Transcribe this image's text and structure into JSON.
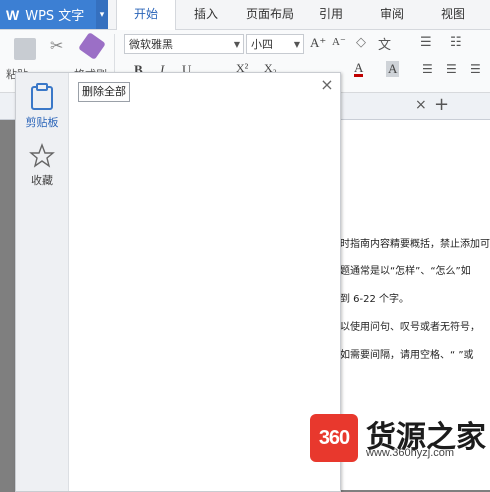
{
  "app": {
    "logo": "W",
    "title": "WPS 文字",
    "menu_arrow": "▾"
  },
  "tabs": [
    {
      "label": "开始",
      "active": true
    },
    {
      "label": "插入"
    },
    {
      "label": "页面布局"
    },
    {
      "label": "引用"
    },
    {
      "label": "审阅"
    },
    {
      "label": "视图"
    }
  ],
  "ribbon": {
    "paste_label": "粘贴",
    "format_painter_label": "格式刷",
    "font_name": "微软雅黑",
    "font_size": "小四",
    "bold": "B",
    "italic": "I",
    "underline": "U",
    "superscript": "X²",
    "subscript": "X₂",
    "font_color_glyph": "A",
    "grow_font": "A⁺",
    "shrink_font": "A⁻",
    "pinyin": "文",
    "highlight_glyph": "A",
    "accent_colors": {
      "font_color": "#c00000",
      "highlight": "#ffff00",
      "brand": "#3c7fd3",
      "watermark": "#e8382d"
    }
  },
  "doc_tabs": {
    "close": "×",
    "add": "+"
  },
  "document": {
    "lines": [
      "时指南内容精要概括，禁止添加可",
      "题通常是以“怎样”、“怎么”如",
      "到 6-22 个字。",
      "以使用问句、叹号或者无符号，",
      "如需要间隔，请用空格、“ ”或"
    ]
  },
  "panel": {
    "delete_all": "删除全部",
    "close": "×",
    "side_items": [
      {
        "label": "剪贴板",
        "icon": "clipboard-icon",
        "active": true
      },
      {
        "label": "收藏",
        "icon": "star-icon",
        "active": false
      }
    ]
  },
  "watermark": {
    "logo_text": "360",
    "name": "货源之家",
    "url": "www.360hyzj.com"
  }
}
